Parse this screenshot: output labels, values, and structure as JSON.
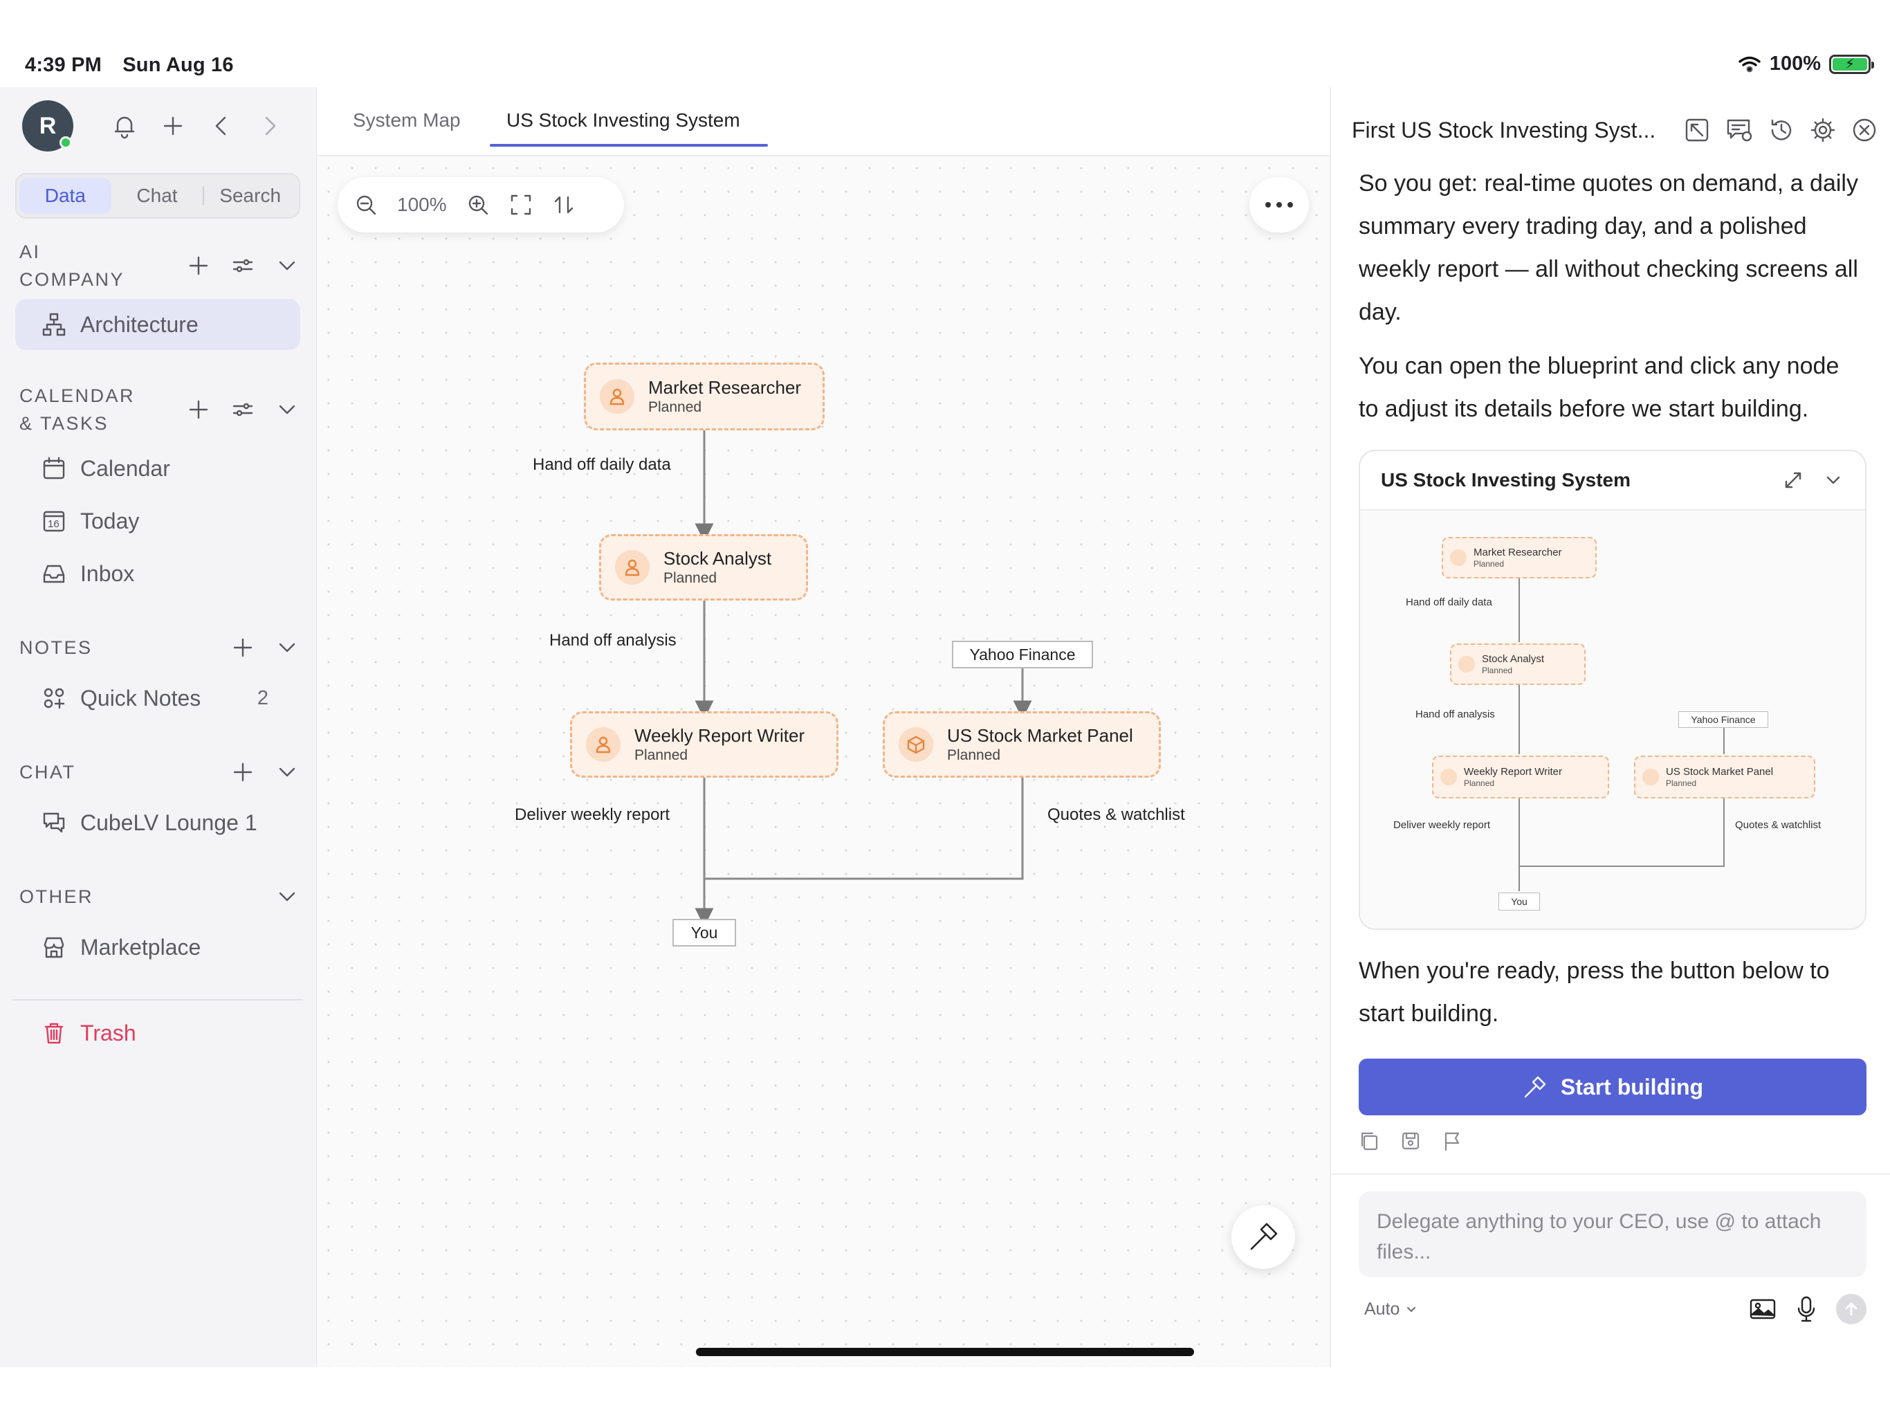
{
  "status_bar": {
    "time": "4:39 PM",
    "date": "Sun Aug 16",
    "battery": "100%"
  },
  "sidebar": {
    "avatar_initial": "R",
    "segments": [
      "Data",
      "Chat",
      "Search"
    ],
    "sections": {
      "ai_company": {
        "title_line1": "AI",
        "title_line2": "COMPANY",
        "items": [
          {
            "label": "Architecture"
          }
        ]
      },
      "calendar": {
        "title_line1": "CALENDAR",
        "title_line2": "& TASKS",
        "items": [
          {
            "label": "Calendar"
          },
          {
            "label": "Today"
          },
          {
            "label": "Inbox"
          }
        ]
      },
      "notes": {
        "title": "NOTES",
        "items": [
          {
            "label": "Quick Notes",
            "count": "2"
          }
        ]
      },
      "chat": {
        "title": "CHAT",
        "items": [
          {
            "label": "CubeLV Lounge 1"
          }
        ]
      },
      "other": {
        "title": "OTHER",
        "items": [
          {
            "label": "Marketplace"
          }
        ]
      }
    },
    "trash_label": "Trash",
    "today_icon_number": "16"
  },
  "main": {
    "tabs": [
      {
        "label": "System Map"
      },
      {
        "label": "US Stock Investing System"
      }
    ],
    "zoom": "100%",
    "diagram": {
      "nodes": {
        "market_researcher": {
          "title": "Market Researcher",
          "status": "Planned"
        },
        "stock_analyst": {
          "title": "Stock Analyst",
          "status": "Planned"
        },
        "weekly_report_writer": {
          "title": "Weekly Report Writer",
          "status": "Planned"
        },
        "market_panel": {
          "title": "US Stock Market Panel",
          "status": "Planned"
        }
      },
      "edge_labels": {
        "daily_data": "Hand off daily data",
        "analysis": "Hand off analysis",
        "weekly_report": "Deliver weekly report",
        "quotes": "Quotes & watchlist"
      },
      "boxes": {
        "source": "Yahoo Finance",
        "target": "You"
      }
    }
  },
  "panel": {
    "title": "First US Stock Investing Syst...",
    "messages": [
      "So you get: real-time quotes on demand, a daily summary every trading day, and a polished weekly report — all without checking screens all day.",
      "You can open the blueprint and click any node to adjust its details before we start building.",
      "When you're ready, press the button below to start building."
    ],
    "preview_title": "US Stock Investing System",
    "start_button": "Start building",
    "composer_placeholder": "Delegate anything to your CEO, use @ to attach files...",
    "model_select": "Auto"
  },
  "colors": {
    "accent": "#5562d6",
    "node_fill": "#fdf1e8",
    "node_border": "#f2b489",
    "danger": "#e23b5e"
  }
}
